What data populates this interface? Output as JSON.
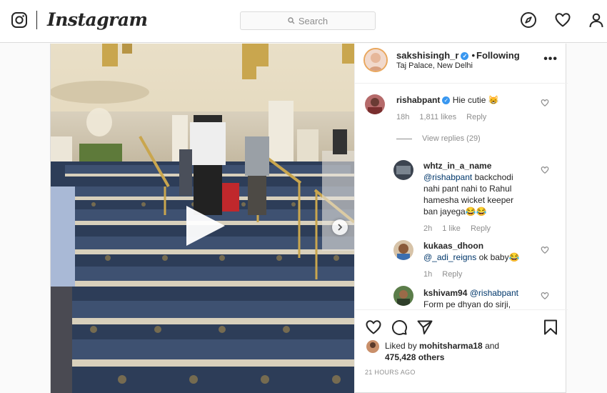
{
  "nav": {
    "wordmark": "Instagram",
    "search_placeholder": "Search",
    "icons": [
      "instagram-glyph-icon",
      "search-icon",
      "explore-compass-icon",
      "activity-heart-icon",
      "profile-icon"
    ]
  },
  "post": {
    "author": "sakshisingh_r",
    "separator": "•",
    "follow_state": "Following",
    "location": "Taj Palace, New Delhi",
    "more": "•••",
    "comments": [
      {
        "user": "rishabpant",
        "verified": true,
        "text": "Hie cutie 😸",
        "time": "18h",
        "likes": "1,811 likes",
        "reply": "Reply",
        "view_replies": "View replies (29)"
      },
      {
        "user": "whtz_in_a_name",
        "mention": "@rishabpant",
        "text": " backchodi nahi pant nahi to Rahul hamesha wicket keeper ban jayega😂😂",
        "time": "2h",
        "likes": "1 like",
        "reply": "Reply"
      },
      {
        "user": "kukaas_dhoon",
        "mention": "@_adi_reigns",
        "text": " ok baby😂",
        "time": "1h",
        "reply": "Reply"
      },
      {
        "user": "kshivam94",
        "mention": "@rishabpant",
        "text": "Form pe dhyan do sirji,"
      }
    ],
    "liked_by_prefix": "Liked by ",
    "liked_by_user": "mohitsharma18",
    "liked_by_mid": " and",
    "others": "475,428 others",
    "timestamp": "21 HOURS AGO"
  },
  "colors": {
    "accent_blue": "#3897f0",
    "mention_blue": "#00376b",
    "muted": "#8e8e8e",
    "border": "#dbdbdb"
  }
}
